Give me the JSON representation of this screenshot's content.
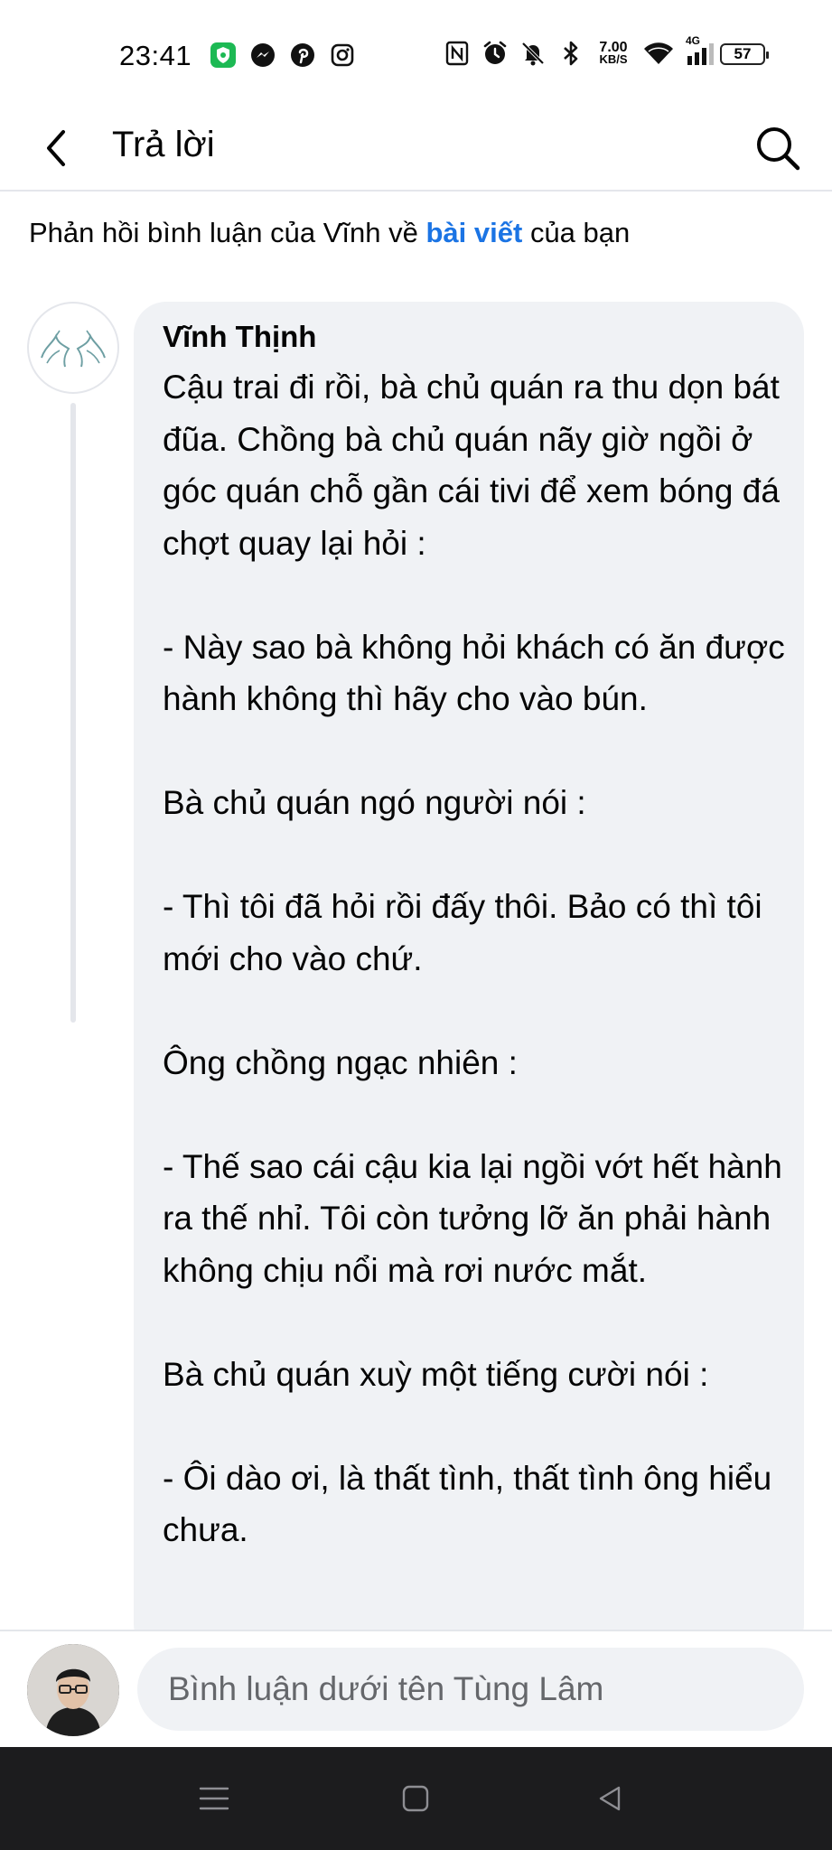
{
  "status_bar": {
    "time": "23:41",
    "net_speed_value": "7.00",
    "net_speed_unit": "KB/S",
    "signal_label": "4G",
    "battery": "57",
    "left_icons": [
      "guard-app-icon",
      "messenger-icon",
      "pinterest-icon",
      "instagram-icon"
    ],
    "right_icons": [
      "nfc-icon",
      "alarm-icon",
      "mute-icon",
      "bluetooth-icon",
      "wifi-icon",
      "cellular-signal-icon"
    ]
  },
  "header": {
    "title": "Trả lời"
  },
  "context": {
    "prefix": "Phản hồi bình luận của Vĩnh về ",
    "link": "bài viết",
    "suffix": " của bạn"
  },
  "comment": {
    "author": "Vĩnh Thịnh",
    "text": "Cậu trai đi rồi, bà chủ quán ra thu dọn bát đũa. Chồng bà chủ quán nãy giờ ngồi ở góc quán chỗ gần cái tivi để xem bóng đá chợt quay lại hỏi :\n\n- Này sao bà không hỏi khách có ăn được hành không thì hãy cho vào bún.\n\nBà chủ quán ngó người nói :\n\n- Thì tôi đã hỏi rồi đấy thôi. Bảo có thì tôi mới cho vào chứ.\n\nÔng chồng ngạc nhiên :\n\n- Thế sao cái cậu kia lại ngồi vớt hết hành ra thế nhỉ. Tôi còn tưởng lỡ ăn phải hành không chịu nổi mà rơi nước mắt.\n\nBà chủ quán xuỳ một tiếng cười nói :\n\n- Ôi dào ơi, là thất tình, thất tình ông hiểu chưa."
  },
  "composer": {
    "placeholder": "Bình luận dưới tên Tùng Lâm"
  }
}
